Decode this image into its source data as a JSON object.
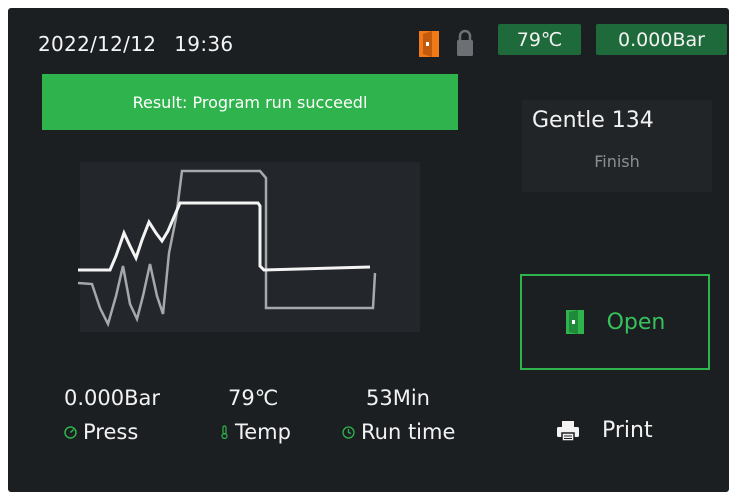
{
  "status_bar": {
    "date": "2022/12/12",
    "time": "19:36",
    "door_icon": "door-open-icon",
    "lock_icon": "lock-icon",
    "temperature": "79℃",
    "pressure": "0.000Bar"
  },
  "result_banner": "Result: Program run succeedl",
  "program": {
    "name": "Gentle 134",
    "status": "Finish"
  },
  "open_button": {
    "label": "Open",
    "icon": "door-open-icon"
  },
  "stats": {
    "pressure": {
      "value": "0.000Bar",
      "label": "Press",
      "icon": "gauge-icon"
    },
    "temperature": {
      "value": "79℃",
      "label": "Temp",
      "icon": "thermometer-icon"
    },
    "run_time": {
      "value": "53Min",
      "label": "Run time",
      "icon": "clock-icon"
    }
  },
  "print_button": {
    "label": "Print",
    "icon": "printer-icon"
  },
  "colors": {
    "background": "#1c1f22",
    "accent_green": "#2fb34c",
    "pill_green": "#1f6a3a",
    "door_orange": "#f07a1a"
  }
}
